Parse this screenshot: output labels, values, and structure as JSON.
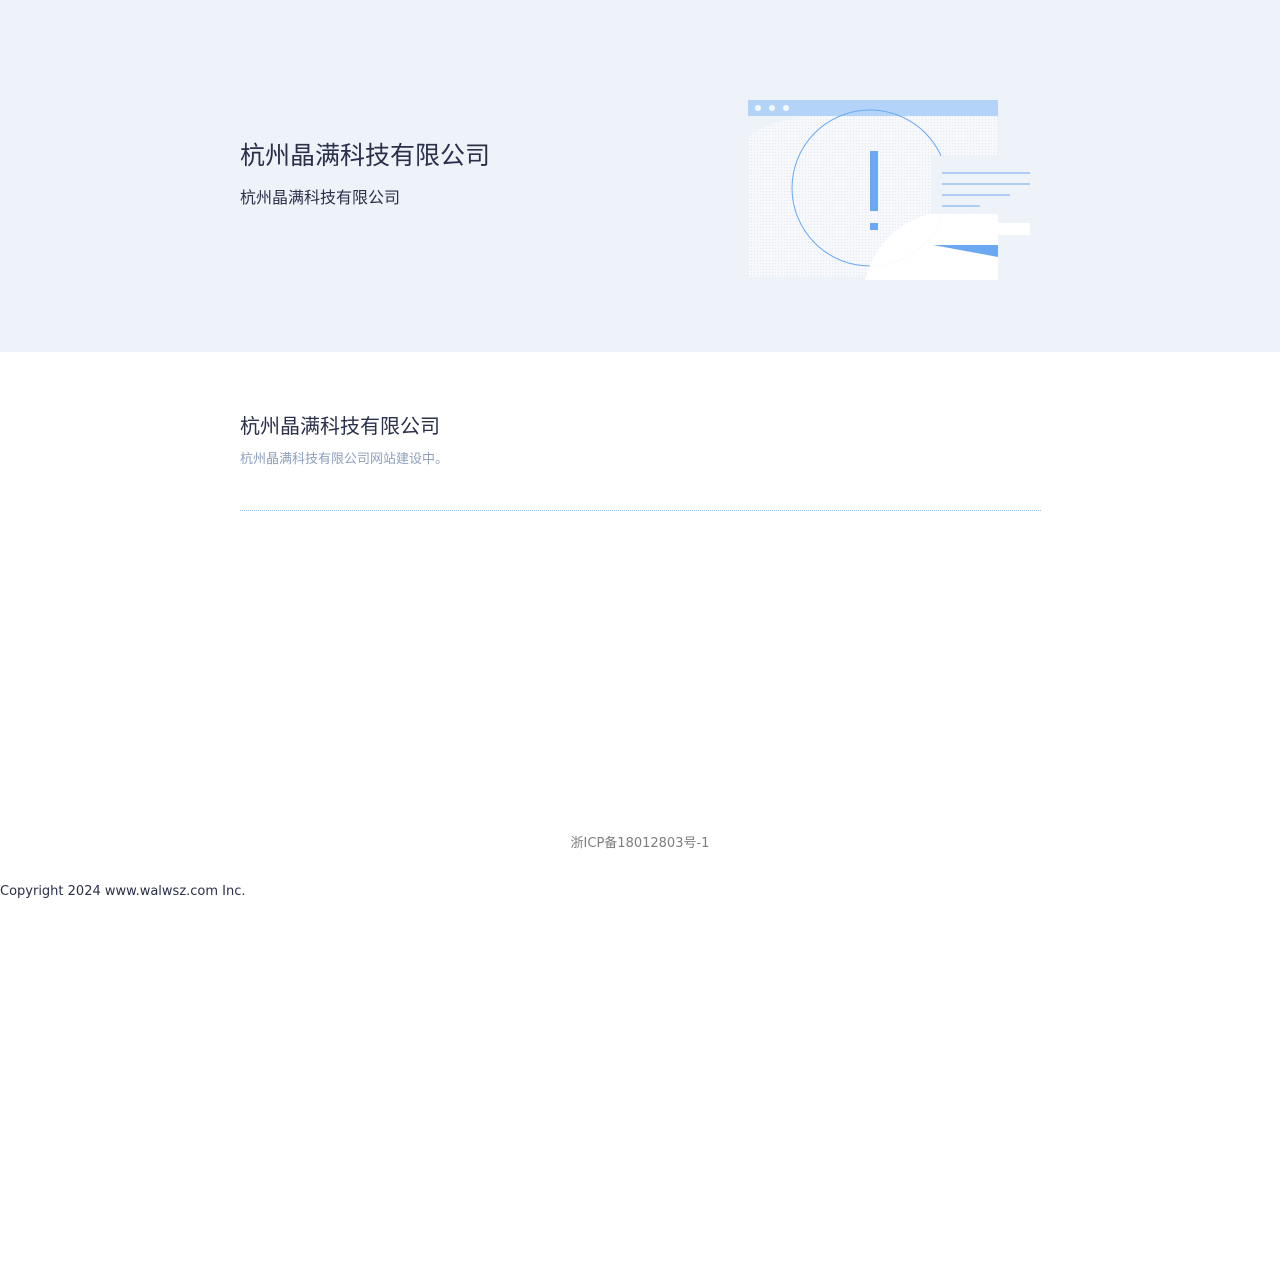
{
  "hero": {
    "title": "杭州晶满科技有限公司",
    "subtitle": "杭州晶满科技有限公司",
    "illustration_icon": "warning-browser-illustration"
  },
  "content": {
    "title": "杭州晶满科技有限公司",
    "message": "杭州晶满科技有限公司网站建设中。"
  },
  "footer": {
    "icp": "浙ICP备18012803号-1",
    "copyright": "Copyright 2024 www.walwsz.com Inc."
  },
  "colors": {
    "hero_background": "#eef3fa",
    "accent_blue": "#6aa9f2",
    "light_blue": "#b3d4f8",
    "title_text": "#2a2f4a",
    "muted_text": "#8ea0bd",
    "footer_text": "#7d7d7d"
  }
}
